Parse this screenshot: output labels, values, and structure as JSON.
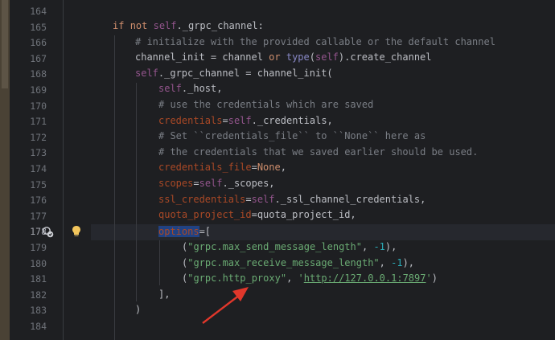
{
  "editor": {
    "current_line": "178",
    "gutter_icons": {
      "line_178_left": "override-icon",
      "line_178_intention": "lightbulb-icon"
    },
    "annotation_color": "#e0372b",
    "lines": [
      {
        "num": "164"
      },
      {
        "num": "165"
      },
      {
        "num": "166"
      },
      {
        "num": "167"
      },
      {
        "num": "168"
      },
      {
        "num": "169"
      },
      {
        "num": "170"
      },
      {
        "num": "171"
      },
      {
        "num": "172"
      },
      {
        "num": "173"
      },
      {
        "num": "174"
      },
      {
        "num": "175"
      },
      {
        "num": "176"
      },
      {
        "num": "177"
      },
      {
        "num": "178"
      },
      {
        "num": "179"
      },
      {
        "num": "180"
      },
      {
        "num": "181"
      },
      {
        "num": "182"
      },
      {
        "num": "183"
      },
      {
        "num": "184"
      }
    ],
    "code": {
      "l165": {
        "kw1": "if",
        "kw2": "not",
        "self": "self",
        "rest": "._grpc_channel:"
      },
      "l166": {
        "comment": "# initialize with the provided callable or the default channel"
      },
      "l167": {
        "a": "channel_init = channel ",
        "or": "or",
        "sp": " ",
        "type": "type",
        "p1": "(",
        "self": "self",
        "rest": ").create_channel"
      },
      "l168": {
        "self": "self",
        "rest": "._grpc_channel = channel_init("
      },
      "l169": {
        "self": "self",
        "rest": "._host,"
      },
      "l170": {
        "comment": "# use the credentials which are saved"
      },
      "l171": {
        "param": "credentials",
        "eq": "=",
        "self": "self",
        "rest": "._credentials,"
      },
      "l172": {
        "comment": "# Set ``credentials_file`` to ``None`` here as"
      },
      "l173": {
        "comment": "# the credentials that we saved earlier should be used."
      },
      "l174": {
        "param": "credentials_file",
        "eq": "=",
        "kw": "None",
        "rest": ","
      },
      "l175": {
        "param": "scopes",
        "eq": "=",
        "self": "self",
        "rest": "._scopes,"
      },
      "l176": {
        "param": "ssl_credentials",
        "eq": "=",
        "self": "self",
        "rest": "._ssl_channel_credentials,"
      },
      "l177": {
        "param": "quota_project_id",
        "rest": "=quota_project_id,"
      },
      "l178": {
        "param": "options",
        "rest": "=["
      },
      "l179": {
        "p": "(",
        "str": "\"grpc.max_send_message_length\"",
        "c": ", ",
        "num": "-1",
        "e": "),"
      },
      "l180": {
        "p": "(",
        "str": "\"grpc.max_receive_message_length\"",
        "c": ", ",
        "num": "-1",
        "e": "),"
      },
      "l181": {
        "p": "(",
        "str": "\"grpc.http_proxy\"",
        "c": ", ",
        "q1": "'",
        "url": "http://127.0.0.1:7897",
        "q2": "'",
        "e": ")"
      },
      "l182": {
        "text": "],"
      },
      "l183": {
        "text": ")"
      }
    }
  }
}
